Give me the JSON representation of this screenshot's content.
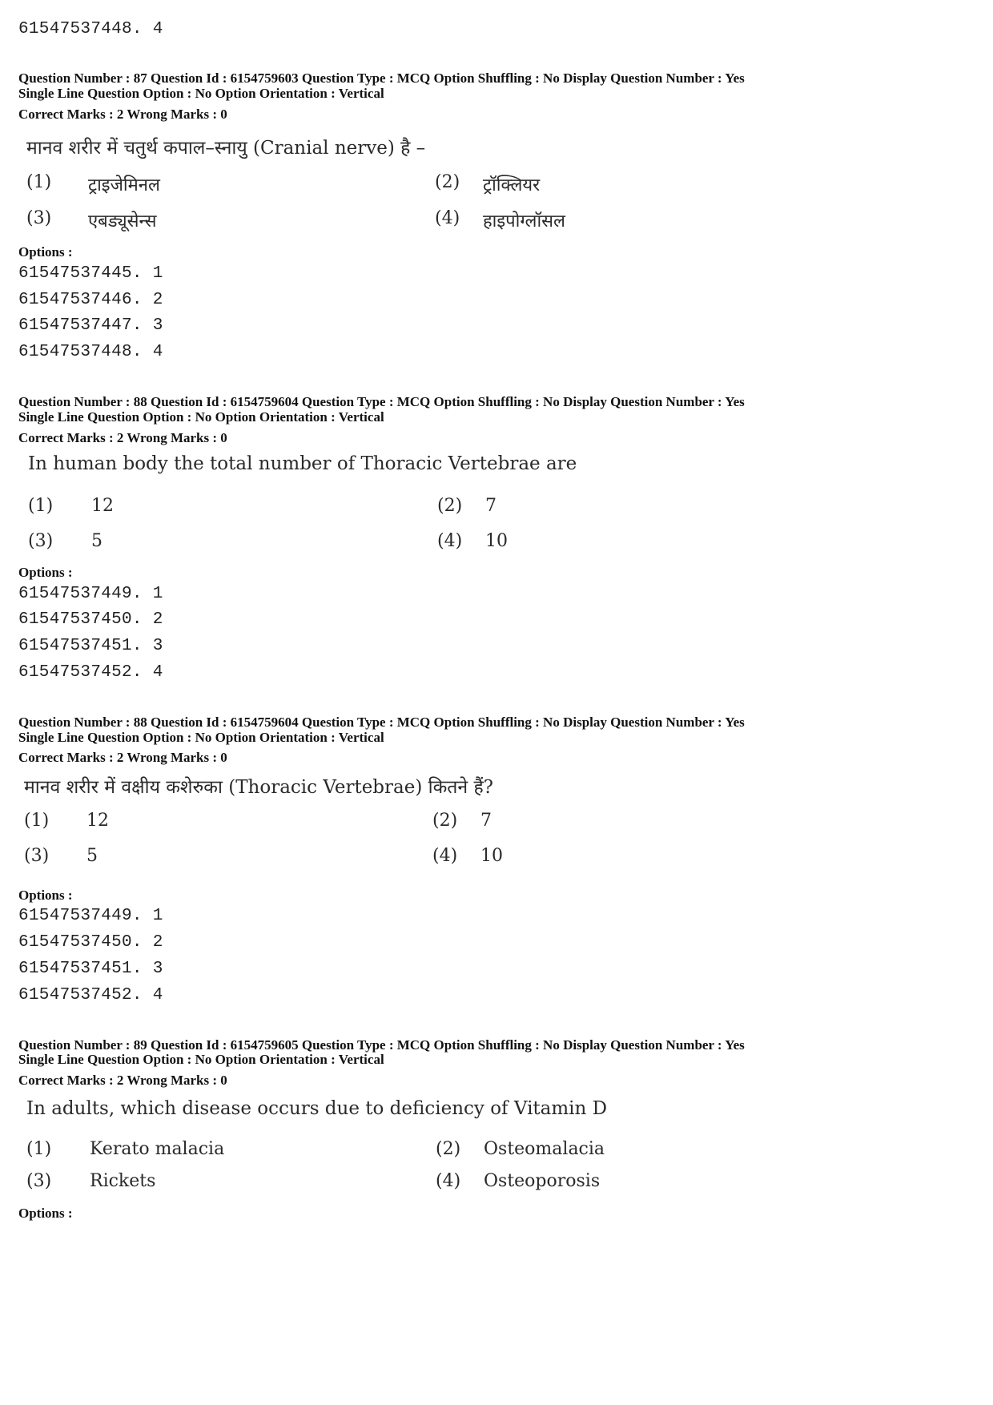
{
  "top_option_line": "61547537448. 4",
  "options_label": "Options :",
  "questions": [
    {
      "meta_line1": "Question Number : 87  Question Id : 6154759603  Question Type : MCQ  Option Shuffling : No  Display Question Number : Yes",
      "meta_line2": "Single Line Question Option : No  Option Orientation : Vertical",
      "marks": "Correct Marks : 2  Wrong Marks : 0",
      "text": "मानव शरीर में चतुर्थ कपाल–स्नायु (Cranial nerve) है –",
      "choices": [
        {
          "num": "(1)",
          "label": "ट्राइजेमिनल"
        },
        {
          "num": "(2)",
          "label": "ट्रॉक्लियर"
        },
        {
          "num": "(3)",
          "label": "एबड्यूसेन्स"
        },
        {
          "num": "(4)",
          "label": "हाइपोग्लॉसल"
        }
      ],
      "option_ids": [
        "61547537445. 1",
        "61547537446. 2",
        "61547537447. 3",
        "61547537448. 4"
      ]
    },
    {
      "meta_line1": "Question Number : 88  Question Id : 6154759604  Question Type : MCQ  Option Shuffling : No  Display Question Number : Yes",
      "meta_line2": "Single Line Question Option : No  Option Orientation : Vertical",
      "marks": "Correct Marks : 2  Wrong Marks : 0",
      "text": "In human body the total number of Thoracic Vertebrae are",
      "choices": [
        {
          "num": "(1)",
          "label": "12"
        },
        {
          "num": "(2)",
          "label": "7"
        },
        {
          "num": "(3)",
          "label": "5"
        },
        {
          "num": "(4)",
          "label": "10"
        }
      ],
      "option_ids": [
        "61547537449. 1",
        "61547537450. 2",
        "61547537451. 3",
        "61547537452. 4"
      ]
    },
    {
      "meta_line1": "Question Number : 88  Question Id : 6154759604  Question Type : MCQ  Option Shuffling : No  Display Question Number : Yes",
      "meta_line2": "Single Line Question Option : No  Option Orientation : Vertical",
      "marks": "Correct Marks : 2  Wrong Marks : 0",
      "text": "मानव शरीर में वक्षीय कशेरुका (Thoracic Vertebrae) कितने हैं?",
      "choices": [
        {
          "num": "(1)",
          "label": "12"
        },
        {
          "num": "(2)",
          "label": "7"
        },
        {
          "num": "(3)",
          "label": "5"
        },
        {
          "num": "(4)",
          "label": "10"
        }
      ],
      "option_ids": [
        "61547537449. 1",
        "61547537450. 2",
        "61547537451. 3",
        "61547537452. 4"
      ]
    },
    {
      "meta_line1": "Question Number : 89  Question Id : 6154759605  Question Type : MCQ  Option Shuffling : No  Display Question Number : Yes",
      "meta_line2": "Single Line Question Option : No  Option Orientation : Vertical",
      "marks": "Correct Marks : 2  Wrong Marks : 0",
      "text": "In adults, which disease occurs due to deficiency of Vitamin D",
      "choices": [
        {
          "num": "(1)",
          "label": "Kerato malacia"
        },
        {
          "num": "(2)",
          "label": "Osteomalacia"
        },
        {
          "num": "(3)",
          "label": "Rickets"
        },
        {
          "num": "(4)",
          "label": "Osteoporosis"
        }
      ],
      "option_ids": []
    }
  ]
}
